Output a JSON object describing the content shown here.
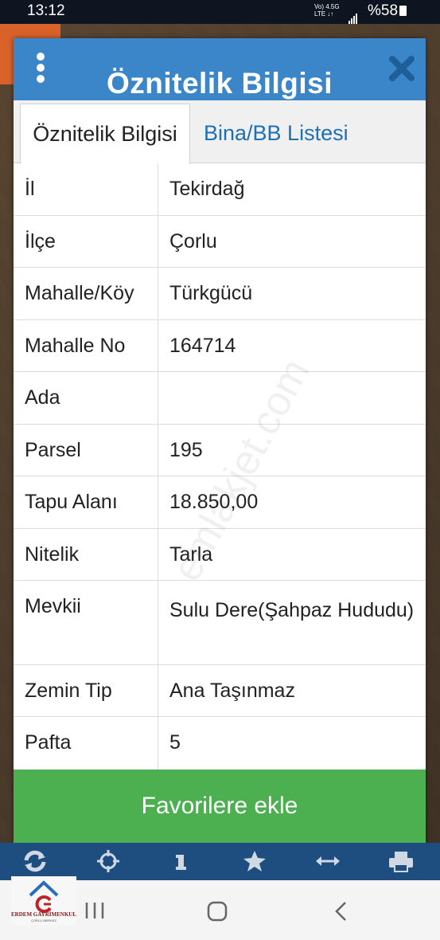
{
  "status_bar": {
    "time": "13:12",
    "network_top": "Vo) 4.5G",
    "network_bottom": "LTE ↓↑",
    "battery": "%58"
  },
  "dialog": {
    "title": "Öznitelik Bilgisi",
    "header_color": "#3a86c8",
    "tabs": [
      {
        "label": "Öznitelik Bilgisi",
        "active": true
      },
      {
        "label": "Bina/BB Listesi",
        "active": false
      }
    ],
    "rows": [
      {
        "key": "İl",
        "value": "Tekirdağ"
      },
      {
        "key": "İlçe",
        "value": "Çorlu"
      },
      {
        "key": "Mahalle/Köy",
        "value": "Türkgücü"
      },
      {
        "key": "Mahalle No",
        "value": "164714"
      },
      {
        "key": "Ada",
        "value": ""
      },
      {
        "key": "Parsel",
        "value": "195"
      },
      {
        "key": "Tapu Alanı",
        "value": "18.850,00"
      },
      {
        "key": "Nitelik",
        "value": "Tarla"
      },
      {
        "key": "Mevkii",
        "value": "Sulu Dere(Şahpaz Hududu)"
      },
      {
        "key": "Zemin Tip",
        "value": "Ana Taşınmaz"
      },
      {
        "key": "Pafta",
        "value": "5"
      }
    ],
    "favorite_button": "Favorilere ekle",
    "favorite_color": "#4caf50"
  },
  "toolbar": {
    "icons": [
      "refresh-icon",
      "crosshair-icon",
      "info-icon",
      "star-icon",
      "measure-icon",
      "print-icon"
    ]
  },
  "watermark": "emlakjet.com",
  "logo": {
    "name": "ERDEM GAYRİMENKUL",
    "sub": "ÇORLU MERKEZ"
  }
}
